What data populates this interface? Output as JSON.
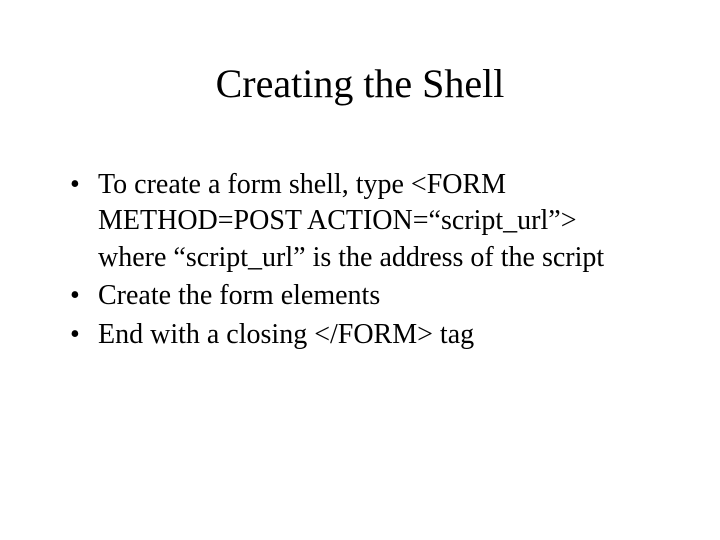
{
  "slide": {
    "title": "Creating the Shell",
    "bullets": [
      "To create a form shell, type <FORM METHOD=POST ACTION=“script_url”> where “script_url” is the address of the script",
      "Create the form elements",
      "End with a closing </FORM> tag"
    ]
  }
}
